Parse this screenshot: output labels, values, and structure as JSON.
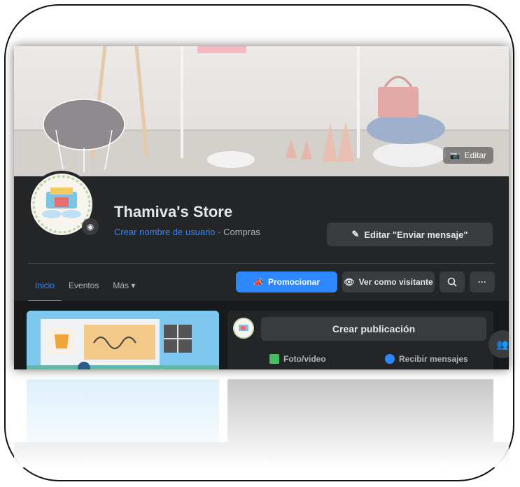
{
  "cover": {
    "edit_label": "Editar"
  },
  "page": {
    "name": "Thamiva's Store",
    "username_link": "Crear nombre de usuario",
    "separator": " · ",
    "category": "Compras",
    "edit_message_button": "Editar \"Enviar mensaje\"",
    "avatar_text": "Thamiva's Store"
  },
  "tabs": [
    {
      "label": "Inicio",
      "active": true
    },
    {
      "label": "Eventos",
      "active": false
    },
    {
      "label": "Más ▾",
      "active": false
    }
  ],
  "actions": {
    "promote": "Promocionar",
    "view_as_visitor": "Ver como visitante",
    "more": "···"
  },
  "composer": {
    "create_post": "Crear publicación",
    "photo_video": "Foto/video",
    "receive_messages": "Recibir mensajes"
  },
  "colors": {
    "accent": "#2d88ff",
    "background": "#242526",
    "surface": "#3a3b3c",
    "text": "#e4e6eb",
    "muted": "#b0b3b8"
  },
  "icons": [
    "camera-icon",
    "pencil-icon",
    "megaphone-icon",
    "eye-icon",
    "search-icon",
    "more-icon",
    "photo-icon",
    "messenger-icon",
    "people-icon"
  ]
}
